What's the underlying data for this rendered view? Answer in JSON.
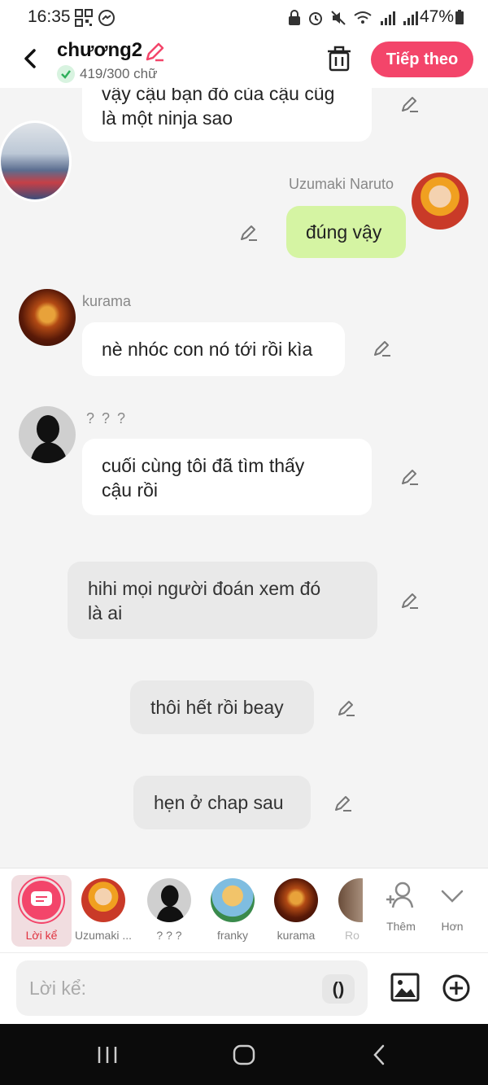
{
  "status_bar": {
    "time": "16:35",
    "battery": "47%"
  },
  "header": {
    "title": "chương2",
    "word_count": "419/300 chữ",
    "next_label": "Tiếp theo"
  },
  "messages": [
    {
      "text_line1": "vậy cậu bạn đó của cậu cũg",
      "text_line2": "là một ninja sao"
    },
    {
      "speaker": "Uzumaki Naruto",
      "text": "đúng vậy"
    },
    {
      "speaker": "kurama",
      "text": "nè nhóc con nó tới rồi kìa"
    },
    {
      "speaker": "? ? ?",
      "text_line1": "cuối cùng tôi đã tìm thấy",
      "text_line2": "cậu rồi"
    },
    {
      "text_line1": "hihi mọi người đoán xem đó",
      "text_line2": "là ai"
    },
    {
      "text": "thôi hết rồi beay"
    },
    {
      "text": "hẹn ở chap sau"
    }
  ],
  "characters": [
    {
      "label": "Lời kể"
    },
    {
      "label": "Uzumaki ..."
    },
    {
      "label": "? ? ?"
    },
    {
      "label": "franky"
    },
    {
      "label": "kurama"
    },
    {
      "label": "Ro"
    },
    {
      "label": "Thêm"
    },
    {
      "label": "Hơn"
    }
  ],
  "input": {
    "placeholder": "Lời kể:",
    "paren_label": "()"
  }
}
